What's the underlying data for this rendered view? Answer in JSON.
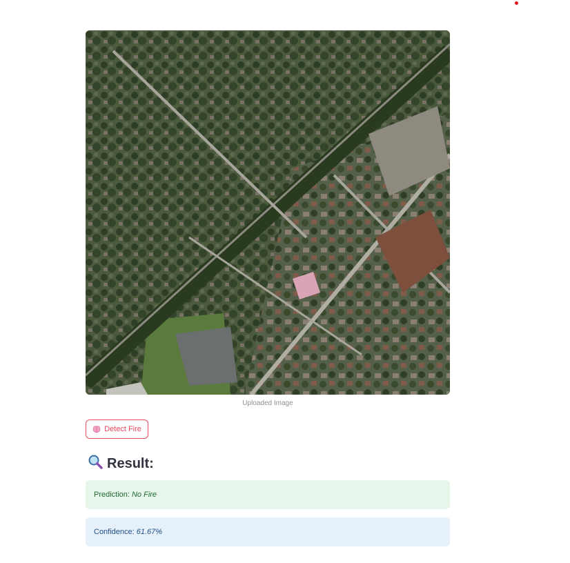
{
  "image": {
    "caption": "Uploaded Image",
    "alt": "Aerial view of a residential neighborhood"
  },
  "detect_button": {
    "icon": "brain-icon",
    "label": "Detect Fire"
  },
  "result": {
    "icon": "magnifying-glass-icon",
    "title": "Result:"
  },
  "prediction": {
    "label": "Prediction:",
    "value": "No Fire"
  },
  "confidence": {
    "label": "Confidence:",
    "value": "61.67%"
  },
  "colors": {
    "accent": "#e8475a",
    "success_bg": "#e7f6ea",
    "success_text": "#1e6a32",
    "info_bg": "#e6f0fb",
    "info_text": "#1f4f87"
  }
}
